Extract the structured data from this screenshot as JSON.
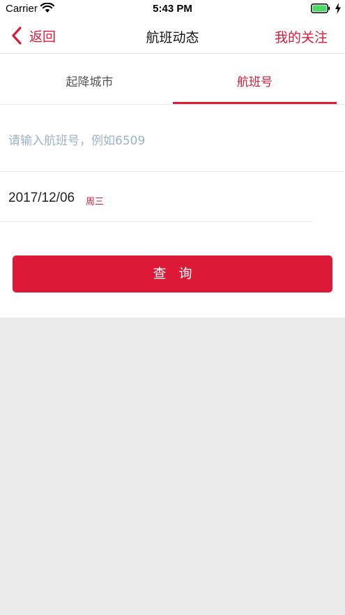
{
  "status_bar": {
    "carrier": "Carrier",
    "time": "5:43 PM",
    "wifi_icon": "wifi-icon",
    "battery_icon": "battery-icon",
    "charging_icon": "charging-bolt-icon",
    "battery_color": "#4cd964"
  },
  "nav": {
    "back_icon": "chevron-left-icon",
    "back_label": "返回",
    "title": "航班动态",
    "my_follow_label": "我的关注"
  },
  "tabs": [
    {
      "label": "起降城市",
      "active": false
    },
    {
      "label": "航班号",
      "active": true
    }
  ],
  "flight_search": {
    "value": "",
    "placeholder": "请输入航班号，例如6509"
  },
  "date": {
    "value": "2017/12/06",
    "weekday": "周三"
  },
  "query_button": {
    "label": "查询"
  },
  "colors": {
    "accent": "#dc1a38",
    "placeholder": "#9db3cc",
    "background": "#ebebeb"
  }
}
